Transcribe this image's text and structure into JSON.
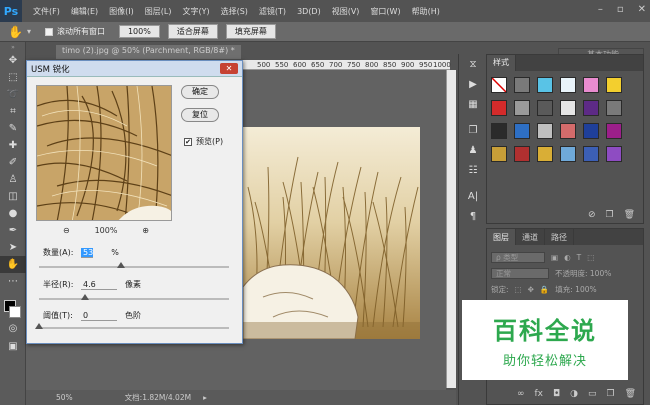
{
  "app": {
    "logo": "Ps"
  },
  "menu": [
    "文件(F)",
    "编辑(E)",
    "图像(I)",
    "图层(L)",
    "文字(Y)",
    "选择(S)",
    "滤镜(T)",
    "3D(D)",
    "视图(V)",
    "窗口(W)",
    "帮助(H)"
  ],
  "options": {
    "scroll_all": "滚动所有窗口",
    "zoom_value": "100%",
    "fit_screen": "适合屏幕",
    "fill_screen": "填充屏幕",
    "workspace": "基本功能"
  },
  "document": {
    "tab": "timo (2).jpg @ 50% (Parchment, RGB/8#) *",
    "ruler_ticks": [
      "500",
      "550",
      "600",
      "650",
      "700",
      "750",
      "800",
      "850",
      "900",
      "950",
      "1000"
    ]
  },
  "status": {
    "zoom": "50%",
    "doc": "文档:1.82M/4.02M"
  },
  "dialog": {
    "title": "USM 锐化",
    "ok": "确定",
    "reset": "复位",
    "preview_label": "预览(P)",
    "preview_checked": "✔",
    "preview_zoom": "100%",
    "amount_label": "数量(A):",
    "amount_value": "53",
    "amount_unit": "%",
    "amount_level": 0.43,
    "radius_label": "半径(R):",
    "radius_value": "4.6",
    "radius_unit": "像素",
    "radius_level": 0.24,
    "threshold_label": "阈值(T):",
    "threshold_value": "0",
    "threshold_unit": "色阶",
    "threshold_level": 0.0
  },
  "styles_panel": {
    "tab": "样式",
    "swatches": [
      "#ffffff",
      "#7a7a7a",
      "#59c3e6",
      "#e9f4fa",
      "#e98ccf",
      "#f3cf2e",
      "#d42b2b",
      "#9a9a9a",
      "#5a5a5a",
      "#e4e4e4",
      "#5d2a86",
      "#7a7a7a",
      "#2b2b2b",
      "#2e6fc4",
      "#bfbfbf",
      "#d46b6b",
      "#1f3f9a",
      "#9c1f8a",
      "#c79e38",
      "#b03030",
      "#d9ae36",
      "#6fa9d9",
      "#3c5fb5",
      "#8e4cc2"
    ]
  },
  "layers_panel": {
    "tabs": [
      "图层",
      "通道",
      "路径"
    ],
    "kind": "ρ 类型",
    "blend": "正常",
    "opacity": "不透明度: 100%",
    "lock": "锁定:",
    "fill": "填充: 100%"
  },
  "watermark": {
    "title": "百科全说",
    "subtitle": "助你轻松解决"
  }
}
